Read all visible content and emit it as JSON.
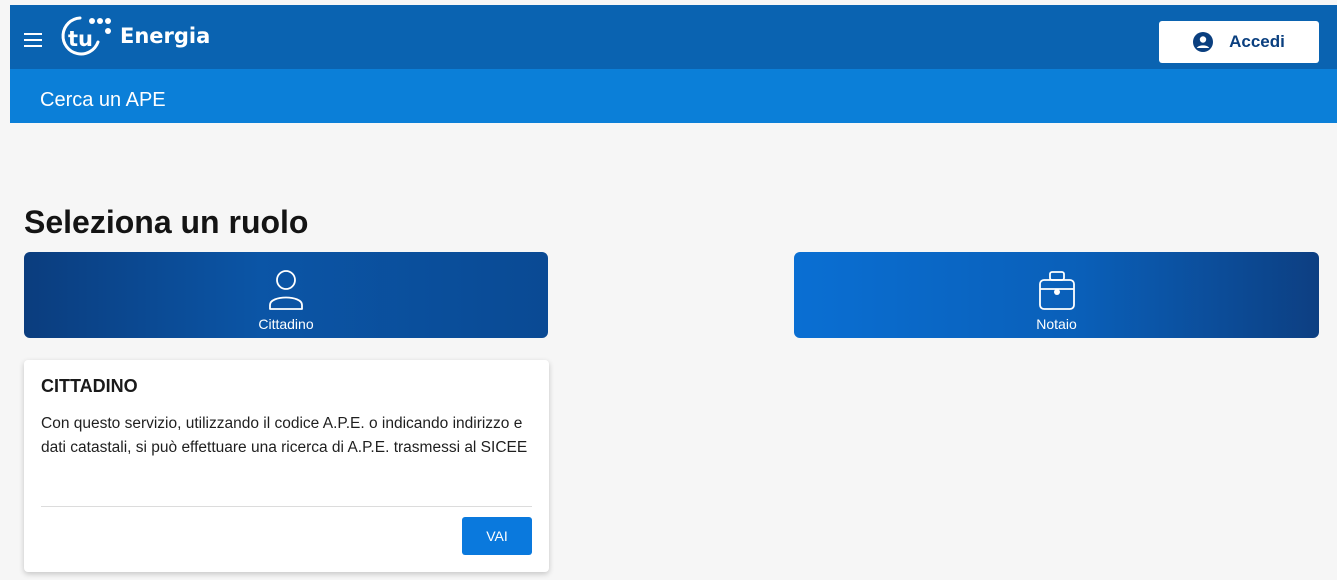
{
  "header": {
    "brand_mark": "tu",
    "brand_name": "Energia",
    "menu_icon": "hamburger-menu-icon",
    "login": {
      "label": "Accedi",
      "icon": "user-circle-icon"
    }
  },
  "subheader": {
    "title": "Cerca un APE"
  },
  "main": {
    "heading": "Seleziona un ruolo",
    "roles": [
      {
        "label": "Cittadino",
        "icon": "person-icon"
      },
      {
        "label": "Notaio",
        "icon": "briefcase-icon"
      }
    ],
    "info_card": {
      "title": "CITTADINO",
      "text": "Con questo servizio, utilizzando il codice A.P.E. o indicando indirizzo e dati catastali, si può effettuare una ricerca di A.P.E. trasmessi al SICEE",
      "button_label": "VAI"
    }
  },
  "colors": {
    "topbar": "#0a63b1",
    "subbar": "#0b7fd8",
    "primary_button": "#0a79dd",
    "background": "#f6f6f6"
  }
}
